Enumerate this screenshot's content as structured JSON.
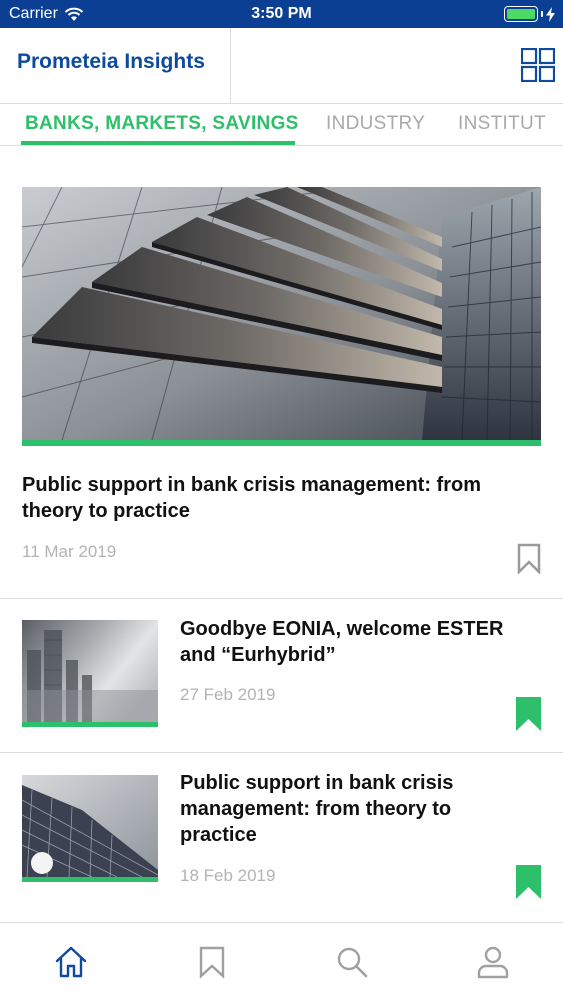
{
  "status_bar": {
    "carrier": "Carrier",
    "time": "3:50 PM"
  },
  "header": {
    "title": "Prometeia Insights"
  },
  "tabs": [
    {
      "label": "BANKS, MARKETS, SAVINGS",
      "active": true
    },
    {
      "label": "INDUSTRY",
      "active": false
    },
    {
      "label": "INSTITUT",
      "active": false
    }
  ],
  "feature": {
    "title": "Public support in bank crisis management: from theory to practice",
    "date": "11 Mar 2019",
    "bookmarked": false
  },
  "articles": [
    {
      "title": "Goodbye EONIA, welcome ESTER and “Eurhybrid”",
      "date": "27 Feb 2019",
      "bookmarked": true
    },
    {
      "title": "Public support in bank crisis management: from theory to practice",
      "date": "18 Feb 2019",
      "bookmarked": true
    }
  ],
  "bottom_nav": {
    "items": [
      "home-icon",
      "bookmark-icon",
      "search-icon",
      "profile-icon"
    ],
    "active": "home-icon"
  },
  "colors": {
    "brand_blue": "#0e4a9e",
    "status_bar": "#0b3f94",
    "accent_green": "#2dbf6a",
    "muted_gray": "#a9a9a9"
  }
}
